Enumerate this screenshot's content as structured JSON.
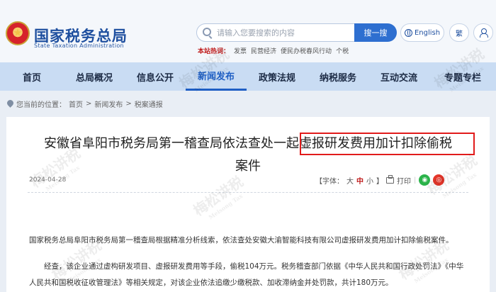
{
  "header": {
    "title": "国家税务总局",
    "subtitle": "State Taxation Administration",
    "search_placeholder": "请输入您要搜索的内容",
    "search_button": "搜一搜",
    "english_label": "English",
    "traditional_label": "繁",
    "hot_label": "本站热词：",
    "hot_words": [
      "发票",
      "民营经济",
      "便民办税春风行动",
      "个税"
    ]
  },
  "nav": {
    "items": [
      {
        "label": "首页"
      },
      {
        "label": "总局概况"
      },
      {
        "label": "信息公开"
      },
      {
        "label": "新闻发布",
        "active": true
      },
      {
        "label": "政策法规"
      },
      {
        "label": "纳税服务"
      },
      {
        "label": "互动交流"
      },
      {
        "label": "专题专栏"
      }
    ]
  },
  "breadcrumb": {
    "prefix": "您当前的位置：",
    "home": "首页",
    "sep1": ">",
    "section": "新闻发布",
    "sep2": ">",
    "page": "税案通报"
  },
  "article": {
    "title_line1": "安徽省阜阳市税务局第一稽查局依法查处一起虚报研发费用加计扣除偷税",
    "title_line2": "案件",
    "date": "2024-04-28",
    "font_label": "【字体：",
    "font_large": "大",
    "font_medium": "中",
    "font_small": "小",
    "font_close": "】",
    "print_label": "打印",
    "para1": "国家税务总局阜阳市税务局第一稽查局根据精准分析线索，依法查处安徽大渝智能科技有限公司虚报研发费用加计扣除偷税案件。",
    "para2": "经查，该企业通过虚构研发项目、虚报研发费用等手段，偷税104万元。税务稽查部门依据《中华人民共和国行政处罚法》《中华人民共和国税收征收管理法》等相关规定，对该企业依法追缴少缴税款、加收滞纳金并处罚款，共计180万元。"
  },
  "watermark": {
    "text": "梅松讲税"
  },
  "colors": {
    "brand": "#1e4f9f",
    "nav_bg": "#c9dcf3",
    "highlight_border": "#e11b1b"
  }
}
